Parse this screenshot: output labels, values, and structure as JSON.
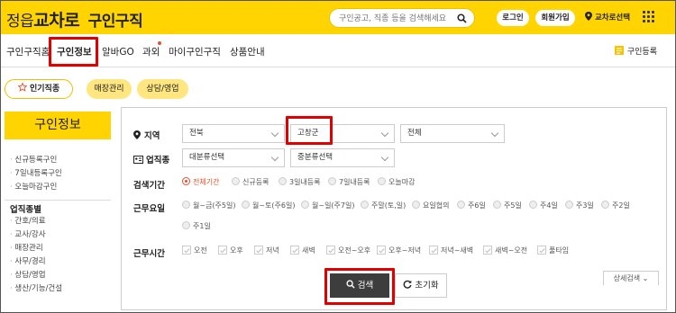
{
  "header": {
    "logo_prefix": "정읍",
    "logo_brand": "교차로",
    "logo_suffix": "구인구직",
    "search_placeholder": "구인공고, 직종 등을 검색해세요",
    "login_label": "로그인",
    "signup_label": "회원가입",
    "location_label": "교차로선택"
  },
  "nav": {
    "items": [
      "구인구직홈",
      "구인정보",
      "알바GO",
      "과외",
      "마이구인구직",
      "상품안내"
    ],
    "register_label": "구인등록"
  },
  "tags": {
    "popular_label": "인기직종",
    "items": [
      "매장관리",
      "상담/영업"
    ]
  },
  "sidebar": {
    "title": "구인정보",
    "links": [
      "신규등록구인",
      "7일내등록구인",
      "오늘마감구인"
    ],
    "category_title": "업직종별",
    "categories": [
      "간호/의료",
      "교사/강사",
      "매장관리",
      "사무/경리",
      "상담/영업",
      "생산/기능/건설"
    ]
  },
  "filters": {
    "region_label": "지역",
    "region_values": [
      "전북",
      "고창군",
      "전체"
    ],
    "job_label": "업직종",
    "job_values": [
      "대분류선택",
      "중분류선택"
    ],
    "period_label": "검색기간",
    "period_options": [
      "전체기간",
      "신규등록",
      "3일내등록",
      "7일내등록",
      "오늘마감"
    ],
    "period_selected": "전체기간",
    "workday_label": "근무요일",
    "workday_options": [
      "월~금(주5일)",
      "월~토(주6일)",
      "월~일(주7일)",
      "주말(토,일)",
      "요일협의",
      "주6일",
      "주5일",
      "주4일",
      "주3일",
      "주2일",
      "주1일"
    ],
    "worktime_label": "근무시간",
    "worktime_options": [
      "오전",
      "오후",
      "저녁",
      "새벽",
      "오전~오후",
      "오후~저녁",
      "저녁~새벽",
      "새벽~오전",
      "풀타임"
    ],
    "search_label": "검색",
    "reset_label": "초기화",
    "detail_label": "상세검색"
  },
  "colors": {
    "brand": "#ffd400",
    "highlight": "#e00000",
    "accent": "#e8502a"
  }
}
